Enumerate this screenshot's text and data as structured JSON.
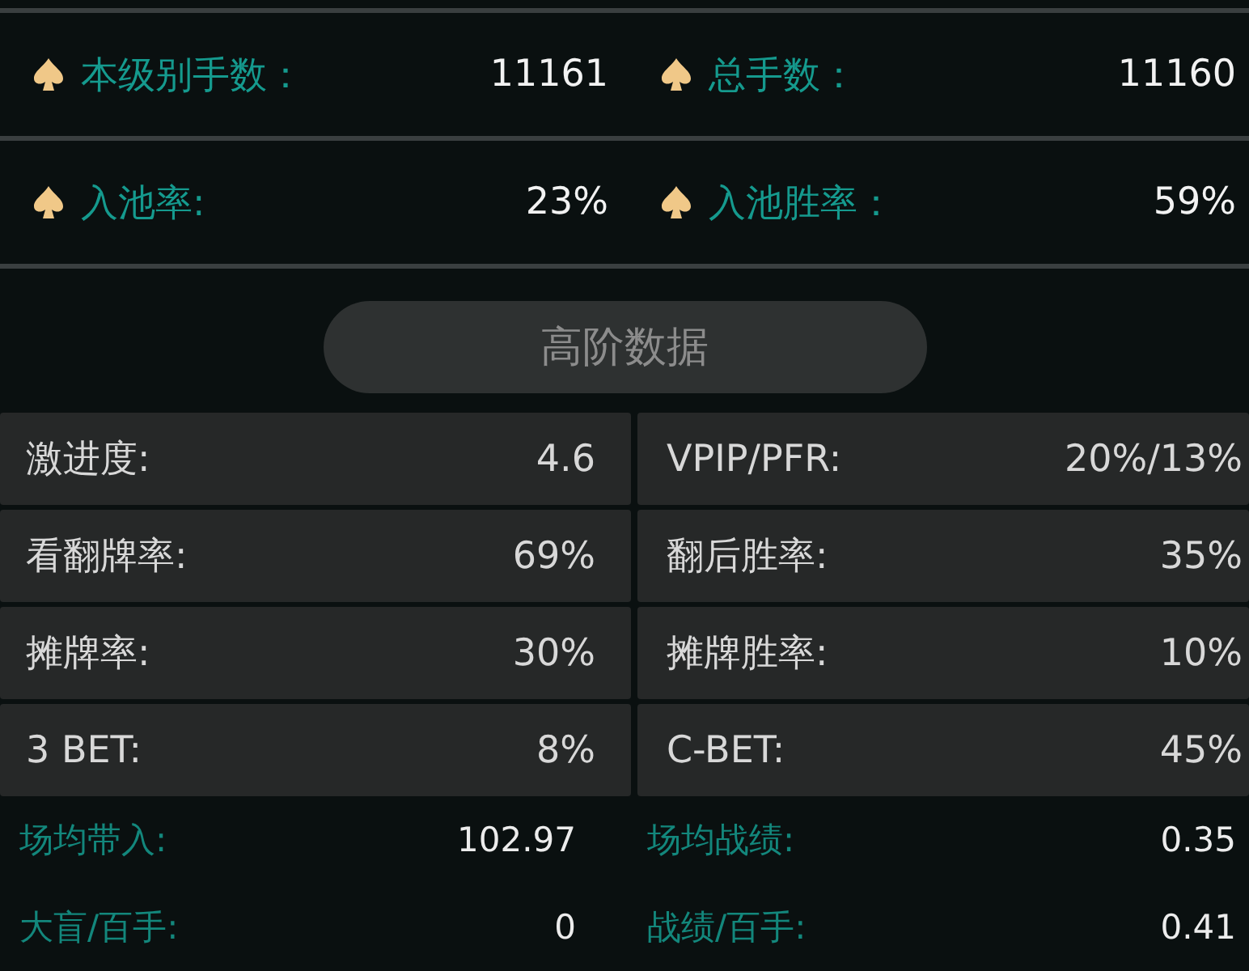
{
  "summary": [
    {
      "label": "本级别手数：",
      "value": "11161"
    },
    {
      "label": "总手数：",
      "value": "11160"
    },
    {
      "label": "入池率:",
      "value": "23%"
    },
    {
      "label": "入池胜率：",
      "value": "59%"
    }
  ],
  "advanced_button": {
    "label": "高阶数据"
  },
  "stats": [
    {
      "label": "激进度:",
      "value": "4.6"
    },
    {
      "label": "VPIP/PFR:",
      "value": "20%/13%"
    },
    {
      "label": "看翻牌率:",
      "value": "69%"
    },
    {
      "label": "翻后胜率:",
      "value": "35%"
    },
    {
      "label": "摊牌率:",
      "value": "30%"
    },
    {
      "label": "摊牌胜率:",
      "value": "10%"
    },
    {
      "label": "3 BET:",
      "value": "8%"
    },
    {
      "label": "C-BET:",
      "value": "45%"
    }
  ],
  "results": [
    {
      "label": "场均带入:",
      "value": "102.97"
    },
    {
      "label": "场均战绩:",
      "value": "0.35"
    },
    {
      "label": "大盲/百手:",
      "value": "0"
    },
    {
      "label": "战绩/百手:",
      "value": "0.41"
    }
  ]
}
